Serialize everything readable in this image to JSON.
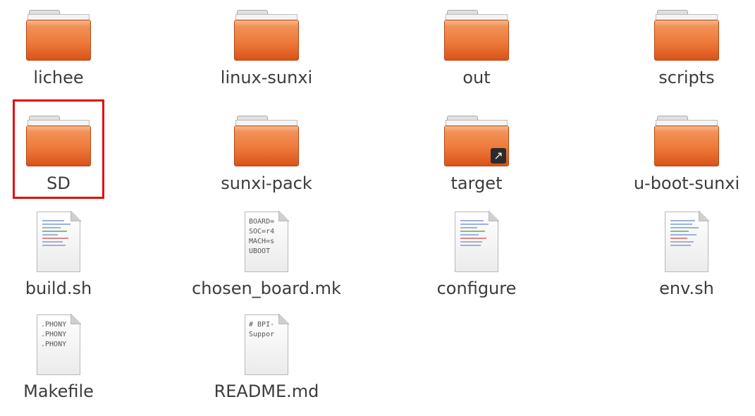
{
  "folders": [
    {
      "name": "lichee"
    },
    {
      "name": "linux-sunxi"
    },
    {
      "name": "out"
    },
    {
      "name": "scripts"
    },
    {
      "name": "SD",
      "highlighted": true
    },
    {
      "name": "sunxi-pack"
    },
    {
      "name": "target",
      "symlink": true,
      "emblem_icon": "link-arrow-icon"
    },
    {
      "name": "u-boot-sunxi"
    }
  ],
  "files": [
    {
      "name": "build.sh",
      "icon": "shell-script-icon"
    },
    {
      "name": "chosen_board.mk",
      "icon": "text-file-icon",
      "preview": [
        "BOARD=",
        "SOC=r4",
        "MACH=s",
        "UBOOT"
      ]
    },
    {
      "name": "configure",
      "icon": "shell-script-icon"
    },
    {
      "name": "env.sh",
      "icon": "shell-script-icon"
    },
    {
      "name": "Makefile",
      "icon": "text-file-icon",
      "preview": [
        ".PHONY",
        ".PHONY",
        ".PHONY"
      ]
    },
    {
      "name": "README.md",
      "icon": "text-file-icon",
      "preview": [
        "# BPI-",
        "Suppor"
      ]
    }
  ],
  "colors": {
    "folder_orange": "#ee7a3a",
    "highlight_red": "#e01010",
    "label_text": "#3c3c3c"
  }
}
